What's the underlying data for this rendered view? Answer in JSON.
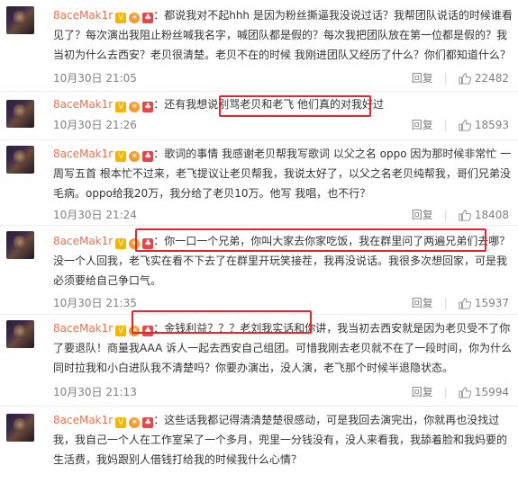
{
  "comments": [
    {
      "username": "8aceMak1r",
      "prefix": "：",
      "text": "都说我对不起hhh 是因为粉丝撕逼我没说过话？我帮团队说话的时候谁看见了？每次演出我阻止粉丝喊我名字，喊团队都是假的？每次我把团队放在第一位都是假的？我当初为什么去西安？老贝很清楚。老贝不在的时候 我刚进团队又经历了什么？你们都知道什么？",
      "time": "10月30日 21:05",
      "reply": "回复",
      "likes": "22482"
    },
    {
      "username": "8aceMak1r",
      "prefix": "：还有我想说",
      "highlight": "别骂老贝和老飞 他们真的对我好过",
      "suffix": "",
      "time": "10月30日 21:26",
      "reply": "回复",
      "likes": "18593"
    },
    {
      "username": "8aceMak1r",
      "prefix": "：",
      "text": "歌词的事情 我感谢老贝帮我写歌词 以父之名 oppo 因为那时候非常忙 一周写五首 根本忙不过来，老飞提议让老贝帮我，我说太好了，以父之名老贝纯帮我，哥们兄弟没毛病。oppo给我20万，我分给了老贝10万。他写 我唱，也不行？",
      "time": "10月30日 21:24",
      "reply": "回复",
      "likes": "18408"
    },
    {
      "username": "8aceMak1r",
      "prefix": "：",
      "highlight": "你一口一个兄弟，你叫大家去你家吃饭，我在群里问了两遍兄弟们去哪？",
      "suffix": "没一个人回我，老飞实在看不下去了在群里开玩笑接茬，我再没说话。我很多次想回家，可是我必须要给自己争口气。",
      "time": "10月30日 21:35",
      "reply": "回复",
      "likes": "15937"
    },
    {
      "username": "8aceMak1r",
      "prefix": "：",
      "highlight": "金钱利益？？？老刘我实话和你讲",
      "suffix": "，我当初去西安就是因为老贝受不了你了要退队！商量我AAA 诉人一起去西安自己组团。可惜我刚去老贝就不在了一段时间，你为什么同时拉我和小白进队我不清楚吗？你要办演出，没人演，老飞那个时候半退隐状态。",
      "time": "10月30日 21:13",
      "reply": "回复",
      "likes": "15994"
    },
    {
      "username": "8aceMak1r",
      "prefix": "：",
      "text": "这些话我都记得清清楚楚很感动，可是我回去演完出，你就再也没找过我，我自己一个人在工作室呆了一个多月，兜里一分钱没有，没人来看我，我舔着脸和我妈要的生活费，我妈跟别人借钱打给我的时候我什么心情？",
      "time": "",
      "reply": "",
      "likes": ""
    }
  ]
}
